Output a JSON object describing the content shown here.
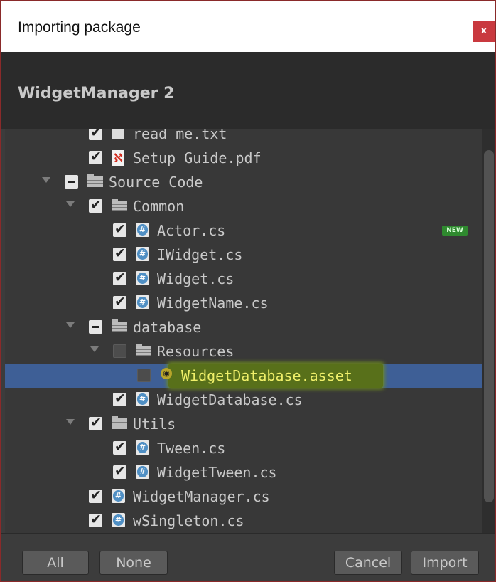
{
  "window": {
    "title": "Importing package",
    "close_symbol": "x"
  },
  "package": {
    "name": "WidgetManager 2"
  },
  "tree": {
    "items": [
      {
        "label": "read me.txt",
        "depth": 2,
        "state": "checked",
        "icon": "text-file-icon",
        "expand": "none"
      },
      {
        "label": "Setup Guide.pdf",
        "depth": 2,
        "state": "checked",
        "icon": "pdf-icon",
        "expand": "none"
      },
      {
        "label": "Source Code",
        "depth": 1,
        "state": "mixed",
        "icon": "folder-icon",
        "expand": "expanded"
      },
      {
        "label": "Common",
        "depth": 2,
        "state": "checked",
        "icon": "folder-icon",
        "expand": "expanded"
      },
      {
        "label": "Actor.cs",
        "depth": 3,
        "state": "checked",
        "icon": "csharp-script-icon",
        "expand": "none",
        "badge": "NEW"
      },
      {
        "label": "IWidget.cs",
        "depth": 3,
        "state": "checked",
        "icon": "csharp-script-icon",
        "expand": "none"
      },
      {
        "label": "Widget.cs",
        "depth": 3,
        "state": "checked",
        "icon": "csharp-script-icon",
        "expand": "none"
      },
      {
        "label": "WidgetName.cs",
        "depth": 3,
        "state": "checked",
        "icon": "csharp-script-icon",
        "expand": "none"
      },
      {
        "label": "database",
        "depth": 2,
        "state": "mixed",
        "icon": "folder-icon",
        "expand": "expanded"
      },
      {
        "label": "Resources",
        "depth": 3,
        "state": "unchecked",
        "icon": "folder-icon",
        "expand": "expanded"
      },
      {
        "label": "WidgetDatabase.asset",
        "depth": 4,
        "state": "unchecked",
        "icon": "asset-icon",
        "expand": "none",
        "selected": true,
        "highlighted": true
      },
      {
        "label": "WidgetDatabase.cs",
        "depth": 3,
        "state": "checked",
        "icon": "csharp-script-icon",
        "expand": "none"
      },
      {
        "label": "Utils",
        "depth": 2,
        "state": "checked",
        "icon": "folder-icon",
        "expand": "expanded"
      },
      {
        "label": "Tween.cs",
        "depth": 3,
        "state": "checked",
        "icon": "csharp-script-icon",
        "expand": "none"
      },
      {
        "label": "WidgetTween.cs",
        "depth": 3,
        "state": "checked",
        "icon": "csharp-script-icon",
        "expand": "none"
      },
      {
        "label": "WidgetManager.cs",
        "depth": 2,
        "state": "checked",
        "icon": "csharp-script-icon",
        "expand": "none"
      },
      {
        "label": "wSingleton.cs",
        "depth": 2,
        "state": "checked",
        "icon": "csharp-script-icon",
        "expand": "none"
      }
    ]
  },
  "buttons": {
    "all": "All",
    "none": "None",
    "cancel": "Cancel",
    "import": "Import"
  }
}
